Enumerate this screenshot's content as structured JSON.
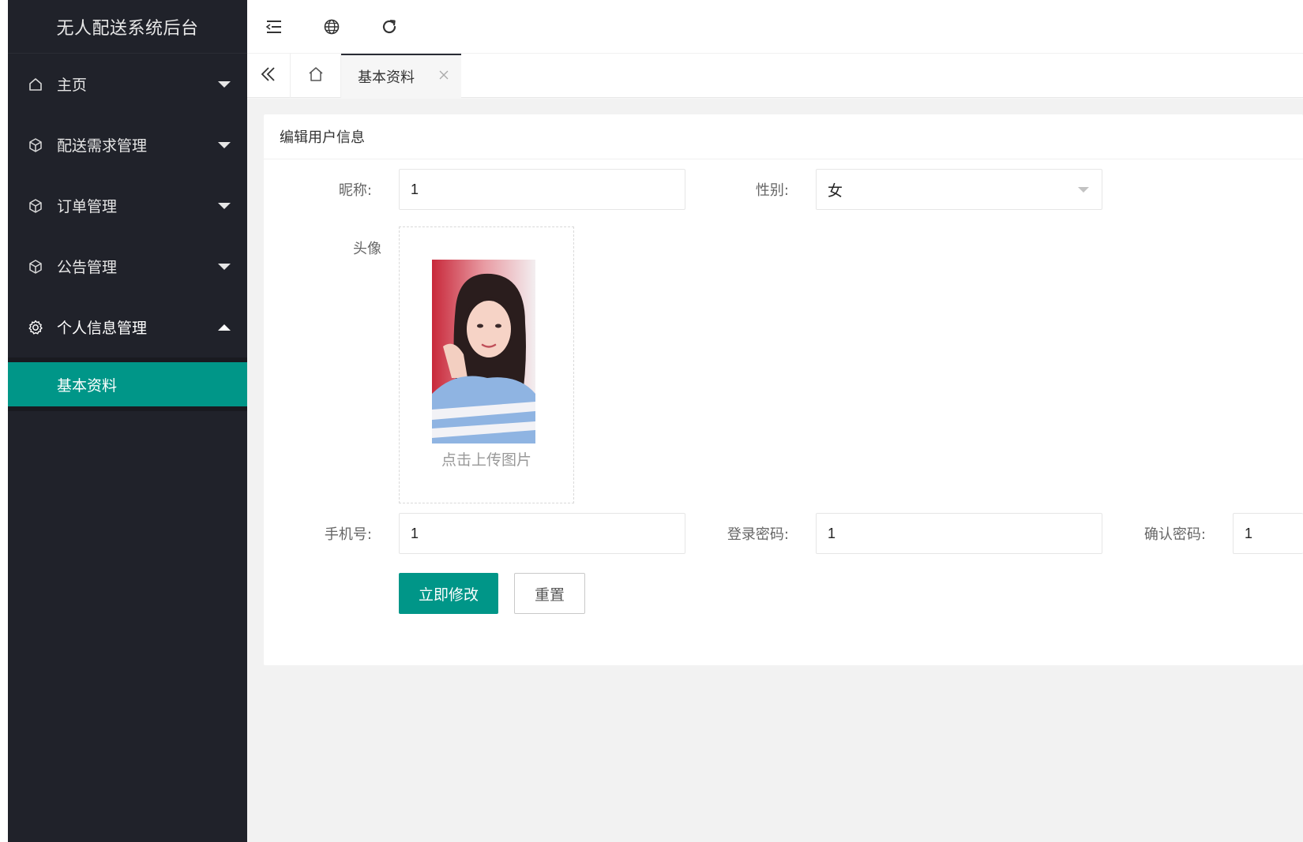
{
  "app": {
    "title": "无人配送系统后台"
  },
  "sidebar": {
    "items": [
      {
        "label": "主页",
        "icon": "home-icon",
        "expanded": false
      },
      {
        "label": "配送需求管理",
        "icon": "cube-icon",
        "expanded": false
      },
      {
        "label": "订单管理",
        "icon": "cube-icon",
        "expanded": false
      },
      {
        "label": "公告管理",
        "icon": "cube-icon",
        "expanded": false
      },
      {
        "label": "个人信息管理",
        "icon": "gear-icon",
        "expanded": true
      }
    ],
    "subitems": [
      {
        "label": "基本资料",
        "active": true
      }
    ]
  },
  "header": {
    "icons": [
      "collapse-menu-icon",
      "globe-icon",
      "refresh-icon"
    ]
  },
  "tabs": {
    "items": [
      {
        "label": "基本资料",
        "active": true
      }
    ]
  },
  "form": {
    "title": "编辑用户信息",
    "nickname": {
      "label": "昵称:",
      "value": "1"
    },
    "gender": {
      "label": "性别:",
      "value": "女"
    },
    "avatar": {
      "label": "头像",
      "upload_text": "点击上传图片"
    },
    "phone": {
      "label": "手机号:",
      "value": "1"
    },
    "password": {
      "label": "登录密码:",
      "value": "1"
    },
    "confirm_password": {
      "label": "确认密码:",
      "value": "1"
    },
    "submit_label": "立即修改",
    "reset_label": "重置"
  },
  "colors": {
    "sidebar_bg": "#20222a",
    "accent": "#009688",
    "content_bg": "#f2f2f2"
  }
}
